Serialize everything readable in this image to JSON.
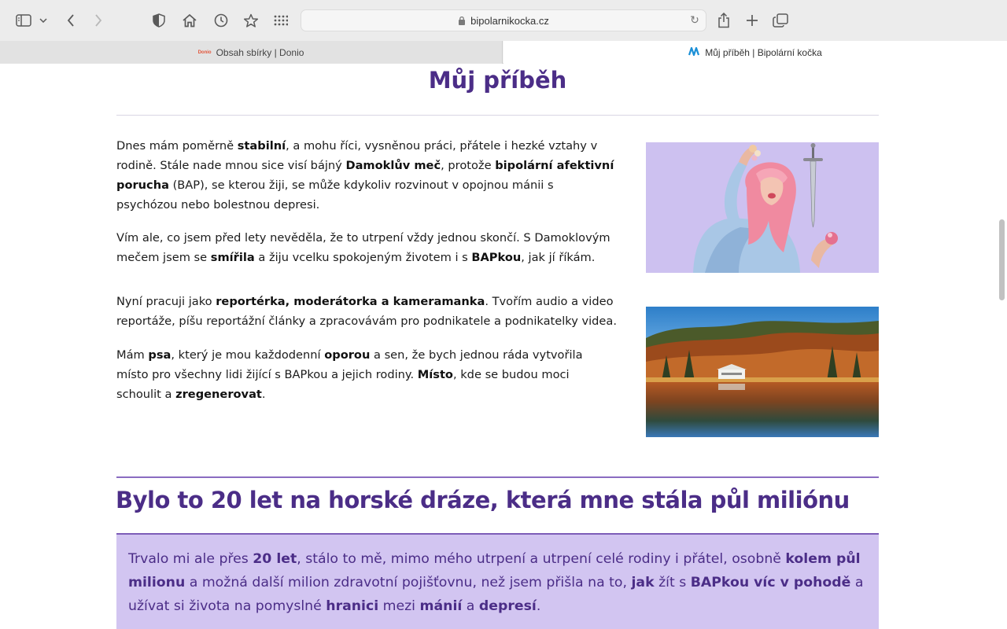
{
  "browser": {
    "url": "bipolarnikocka.cz",
    "tabs": [
      {
        "label": "Obsah sbírky | Donio",
        "favicon_text": "Donio",
        "active": false
      },
      {
        "label": "Můj příběh | Bipolární kočka",
        "favicon_text": "ꟿ",
        "active": true
      }
    ],
    "icons": {
      "sidebar": "sidebar-icon",
      "back": "chevron-left-icon",
      "forward": "chevron-right-icon",
      "privacy": "shield-icon",
      "home": "home-icon",
      "history": "clock-icon",
      "bookmark": "star-icon",
      "extensions": "grid-icon",
      "share": "share-icon",
      "new_tab": "plus-icon",
      "tabs_overview": "tabs-icon"
    }
  },
  "page": {
    "title": "Můj příběh",
    "p1": [
      {
        "t": "Dnes mám poměrně ",
        "b": false
      },
      {
        "t": "stabilní",
        "b": true
      },
      {
        "t": ", a mohu říci, vysněnou práci, přátele i hezké vztahy v rodině. Stále nade mnou sice visí bájný ",
        "b": false
      },
      {
        "t": "Damoklův meč",
        "b": true
      },
      {
        "t": ", protože ",
        "b": false
      },
      {
        "t": "bipolární afektivní porucha",
        "b": true
      },
      {
        "t": " (BAP), se kterou žiji, se může kdykoliv rozvinout v opojnou mánii s psychózou nebo bolestnou depresi.",
        "b": false
      }
    ],
    "p2": [
      {
        "t": "Vím ale, co jsem před lety nevěděla, že to utrpení vždy jednou skončí. S Damoklovým mečem jsem se ",
        "b": false
      },
      {
        "t": "smířila",
        "b": true
      },
      {
        "t": " a žiju vcelku spokojeným životem i s ",
        "b": false
      },
      {
        "t": "BAPkou",
        "b": true
      },
      {
        "t": ", jak jí říkám.",
        "b": false
      }
    ],
    "p3": [
      {
        "t": "Nyní pracuji jako ",
        "b": false
      },
      {
        "t": "reportérka, moderátorka a kameramanka",
        "b": true
      },
      {
        "t": ". Tvořím audio a video reportáže, píšu reportážní články a zpracovávám pro podnikatele a podnikatelky videa.",
        "b": false
      }
    ],
    "p4": [
      {
        "t": "Mám ",
        "b": false
      },
      {
        "t": "psa",
        "b": true
      },
      {
        "t": ", který je mou každodenní ",
        "b": false
      },
      {
        "t": "oporou",
        "b": true
      },
      {
        "t": " a sen, že bych jednou ráda vytvořila místo pro všechny lidi žijící s BAPkou a jejich rodiny. ",
        "b": false
      },
      {
        "t": "Místo",
        "b": true
      },
      {
        "t": ", kde se budou moci schoulit a ",
        "b": false
      },
      {
        "t": "zregenerovat",
        "b": true
      },
      {
        "t": ".",
        "b": false
      }
    ],
    "section_title": "Bylo to 20 let na horské dráze, která mne stála půl miliónu",
    "callout": [
      {
        "t": "Trvalo mi ale přes ",
        "b": false
      },
      {
        "t": "20 let",
        "b": true
      },
      {
        "t": ",  stálo to mě, mimo mého utrpení a utrpení celé rodiny i přátel, osobně ",
        "b": false
      },
      {
        "t": "kolem půl milionu",
        "b": true
      },
      {
        "t": " a možná další milion zdravotní pojišťovnu, než jsem přišla na to, ",
        "b": false
      },
      {
        "t": "jak",
        "b": true
      },
      {
        "t": " žít s ",
        "b": false
      },
      {
        "t": "BAPkou víc v pohodě",
        "b": true
      },
      {
        "t": " a užívat si života na pomyslné ",
        "b": false
      },
      {
        "t": "hranici",
        "b": true
      },
      {
        "t": " mezi ",
        "b": false
      },
      {
        "t": "mánií",
        "b": true
      },
      {
        "t": " a ",
        "b": false
      },
      {
        "t": "depresí",
        "b": true
      },
      {
        "t": ".",
        "b": false
      }
    ]
  },
  "colors": {
    "accent": "#4b2d87",
    "callout_bg": "#d2c5f1",
    "image1_bg": "#cfc3f2"
  }
}
